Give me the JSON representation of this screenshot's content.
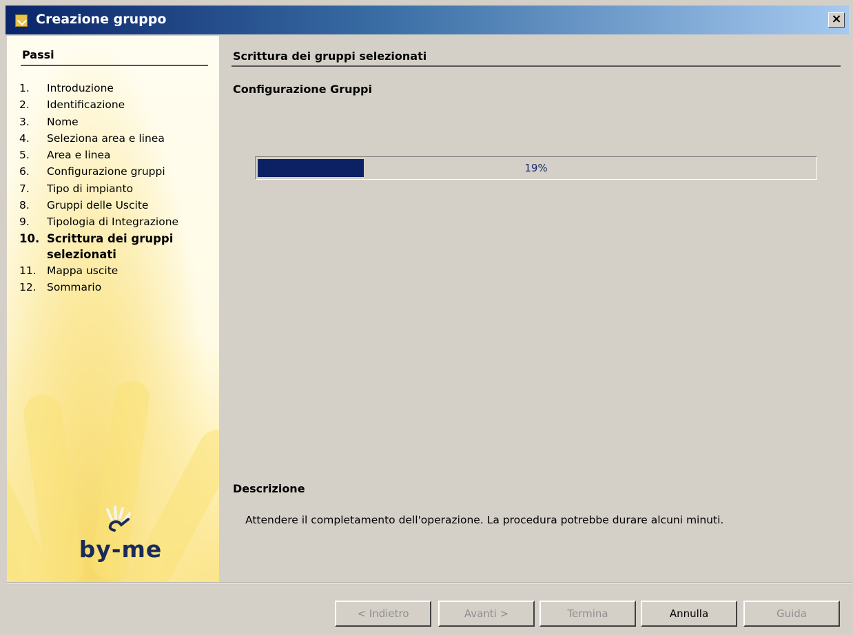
{
  "window": {
    "title": "Creazione gruppo",
    "close_label": "×"
  },
  "steps_panel": {
    "heading": "Passi",
    "steps": [
      {
        "num": "1.",
        "label": "Introduzione"
      },
      {
        "num": "2.",
        "label": "Identificazione"
      },
      {
        "num": "3.",
        "label": "Nome"
      },
      {
        "num": "4.",
        "label": "Seleziona area e linea"
      },
      {
        "num": "5.",
        "label": "Area e linea"
      },
      {
        "num": "6.",
        "label": "Configurazione gruppi"
      },
      {
        "num": "7.",
        "label": "Tipo di impianto"
      },
      {
        "num": "8.",
        "label": "Gruppi delle Uscite"
      },
      {
        "num": "9.",
        "label": "Tipologia di Integrazione"
      },
      {
        "num": "10.",
        "label": "Scrittura dei gruppi selezionati"
      },
      {
        "num": "11.",
        "label": "Mappa uscite"
      },
      {
        "num": "12.",
        "label": "Sommario"
      }
    ],
    "current_step": 10,
    "logo_text": "by-me"
  },
  "main": {
    "section_title": "Scrittura dei gruppi selezionati",
    "subtitle": "Configurazione Gruppi",
    "progress": {
      "value": 0.19,
      "label": "19%",
      "fill_color": "#0b2163"
    },
    "description_title": "Descrizione",
    "description_text": "Attendere il completamento dell'operazione. La procedura potrebbe durare alcuni minuti."
  },
  "buttons": {
    "back": {
      "label": "< Indietro",
      "enabled": false
    },
    "next": {
      "label": "Avanti >",
      "enabled": false
    },
    "finish": {
      "label": "Termina",
      "enabled": false
    },
    "cancel": {
      "label": "Annulla",
      "enabled": true
    },
    "help": {
      "label": "Guida",
      "enabled": false
    }
  }
}
